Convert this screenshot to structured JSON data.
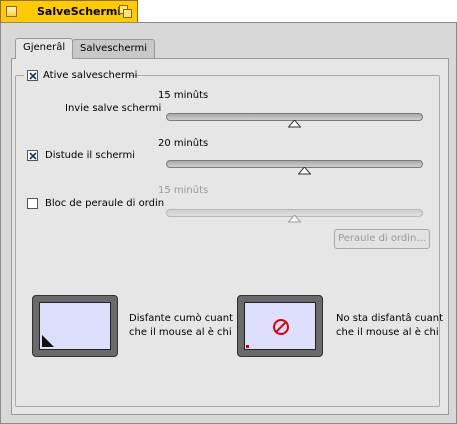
{
  "window": {
    "title": "SalveSchermi"
  },
  "tabs": [
    {
      "label": "Gjenerâl",
      "active": true
    },
    {
      "label": "Salveschermi",
      "active": false
    }
  ],
  "screensaver": {
    "enable_label": "Ative salveschermi",
    "enable_checked": true,
    "start_label": "Invie salve schermi",
    "start_value": "15 minûts",
    "start_level": 0.5
  },
  "turn_off": {
    "label": "Distude il schermi",
    "checked": true,
    "value": "20 minûts",
    "level": 0.54
  },
  "lock": {
    "label": "Bloc de peraule di ordin",
    "checked": false,
    "value": "15 minûts",
    "level": 0.5,
    "password_button": "Peraule di ordin..."
  },
  "corners": {
    "activate_label_line1": "Disfante cumò cuant",
    "activate_label_line2": "che il mouse al è chi",
    "never_label_line1": "No sta disfantâ cuant",
    "never_label_line2": "che il mouse al è chi"
  },
  "colors": {
    "title_tab": "#ffcb00",
    "never_icon": "#e00000",
    "screen": "#ddddfc"
  }
}
